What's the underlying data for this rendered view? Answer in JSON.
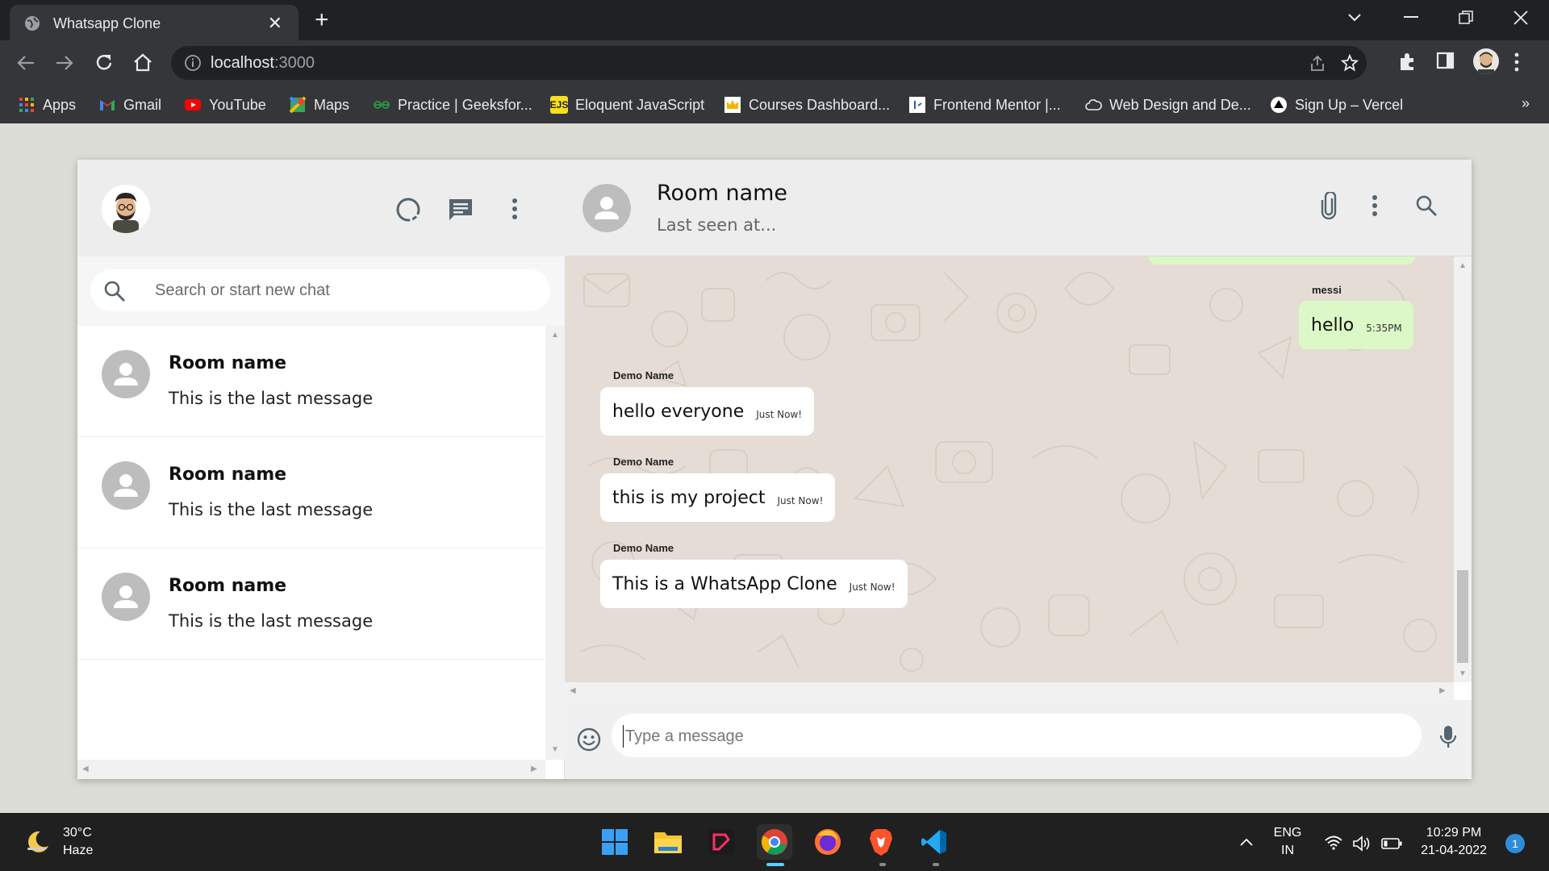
{
  "browser": {
    "tab_title": "Whatsapp Clone",
    "url_host": "localhost",
    "url_port": ":3000",
    "bookmarks": [
      {
        "label": "Apps",
        "icon": "apps-grid-icon"
      },
      {
        "label": "Gmail",
        "icon": "gmail-icon"
      },
      {
        "label": "YouTube",
        "icon": "youtube-icon"
      },
      {
        "label": "Maps",
        "icon": "maps-icon"
      },
      {
        "label": "Practice | Geeksfor...",
        "icon": "geeksforgeeks-icon"
      },
      {
        "label": "Eloquent JavaScript",
        "icon": "ejs-icon"
      },
      {
        "label": "Courses Dashboard...",
        "icon": "crown-icon"
      },
      {
        "label": "Frontend Mentor |...",
        "icon": "frontend-mentor-icon"
      },
      {
        "label": "Web Design and De...",
        "icon": "cloud-icon"
      },
      {
        "label": "Sign Up – Vercel",
        "icon": "vercel-icon"
      }
    ],
    "more_bookmarks": "»"
  },
  "sidebar": {
    "search_placeholder": "Search or start new chat",
    "chats": [
      {
        "name": "Room name",
        "last_message": "This is the last message"
      },
      {
        "name": "Room name",
        "last_message": "This is the last message"
      },
      {
        "name": "Room name",
        "last_message": "This is the last message"
      }
    ]
  },
  "chat": {
    "room_name": "Room name",
    "last_seen": "Last seen at...",
    "messages": [
      {
        "sender": "messi",
        "text": "hello",
        "time": "5:35PM",
        "sent": true
      },
      {
        "sender": "Demo Name",
        "text": "hello everyone",
        "time": "Just Now!",
        "sent": false
      },
      {
        "sender": "Demo Name",
        "text": "this is my project",
        "time": "Just Now!",
        "sent": false
      },
      {
        "sender": "Demo Name",
        "text": "This is a WhatsApp Clone",
        "time": "Just Now!",
        "sent": false
      }
    ],
    "input_placeholder": "Type a message"
  },
  "taskbar": {
    "temperature": "30°C",
    "weather": "Haze",
    "lang_top": "ENG",
    "lang_bottom": "IN",
    "time": "10:29 PM",
    "date": "21-04-2022",
    "notifications": "1"
  },
  "colors": {
    "sent_bubble": "#dcf8c6",
    "received_bubble": "#ffffff",
    "chat_bg": "#e5ddd5",
    "header_bg": "#ededed"
  }
}
